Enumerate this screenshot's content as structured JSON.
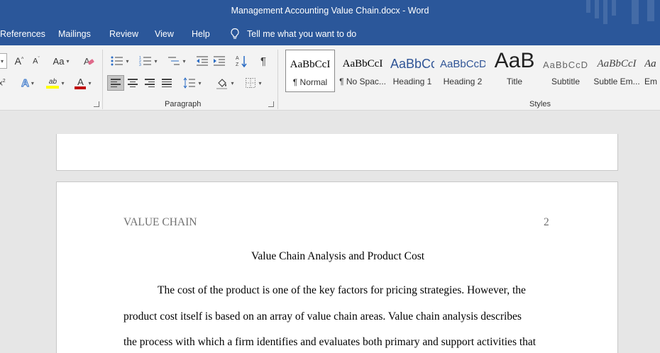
{
  "window": {
    "title": "Management Accounting Value Chain.docx  -  Word"
  },
  "menu": {
    "tabs": [
      "References",
      "Mailings",
      "Review",
      "View",
      "Help"
    ],
    "tell_me": "Tell me what you want to do"
  },
  "ribbon": {
    "paragraph_label": "Paragraph",
    "styles_label": "Styles",
    "font_case_label": "Aa",
    "styles": [
      {
        "sample": "AaBbCcI",
        "name": "¶ Normal"
      },
      {
        "sample": "AaBbCcI",
        "name": "¶ No Spac..."
      },
      {
        "sample": "AaBbCc",
        "name": "Heading 1"
      },
      {
        "sample": "AaBbCcD",
        "name": "Heading 2"
      },
      {
        "sample": "AaB",
        "name": "Title"
      },
      {
        "sample": "AaBbCcD",
        "name": "Subtitle"
      },
      {
        "sample": "AaBbCcI",
        "name": "Subtle Em..."
      },
      {
        "sample": "Aa",
        "name": "Em"
      }
    ]
  },
  "document": {
    "header_left": "VALUE CHAIN",
    "page_number": "2",
    "heading": "Value Chain Analysis and Product Cost",
    "lines": [
      "The cost of the product is one of the key factors for pricing strategies. However, the",
      "product cost itself is based on an array of value chain areas. Value chain analysis describes",
      "the process with which a firm identifies and evaluates both primary and support activities that"
    ]
  },
  "colors": {
    "word_blue": "#2b579a",
    "highlight_yellow": "#ffff00",
    "font_color_red": "#c00000",
    "heading_blue": "#2f5496"
  }
}
